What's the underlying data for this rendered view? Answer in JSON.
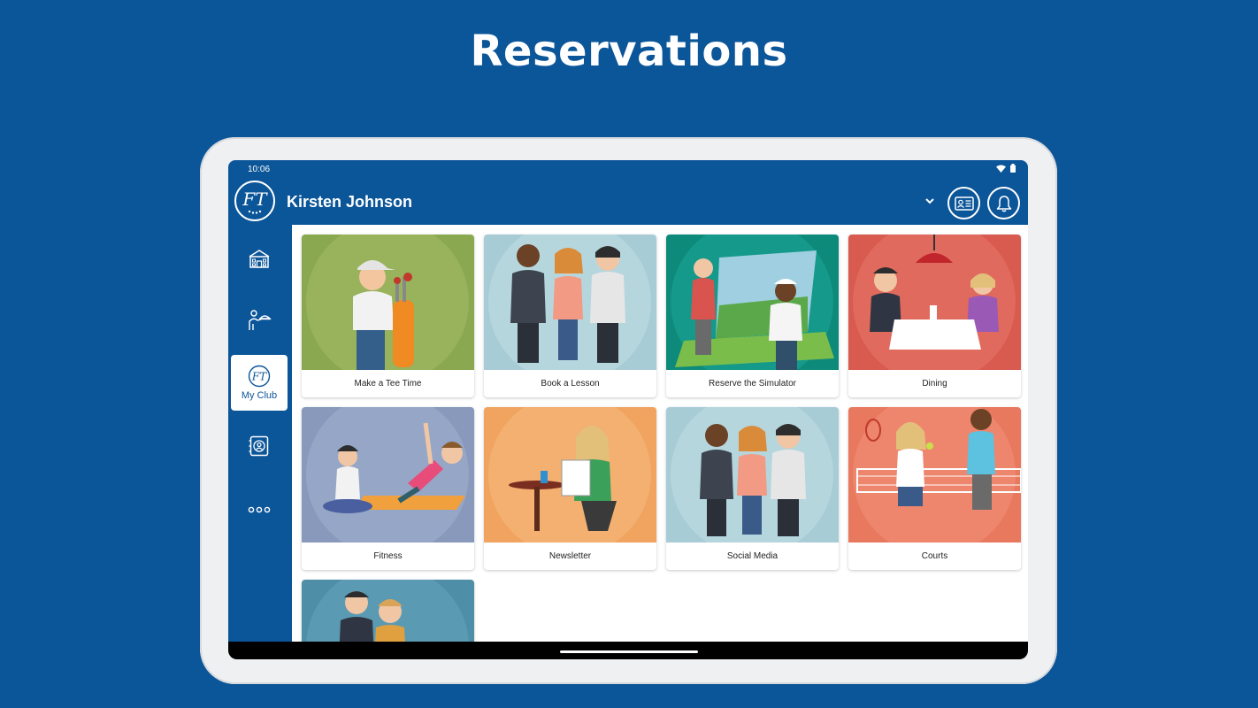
{
  "page": {
    "headline": "Reservations"
  },
  "statusbar": {
    "time": "10:06",
    "wifi_icon": "wifi-icon",
    "battery_icon": "battery-icon"
  },
  "appbar": {
    "logo_text": "FT",
    "user_name": "Kirsten Johnson",
    "dropdown_icon": "chevron-down-icon",
    "card_icon": "member-card-icon",
    "bell_icon": "bell-icon"
  },
  "sidebar": {
    "items": [
      {
        "icon": "clubhouse-icon",
        "label": ""
      },
      {
        "icon": "waiter-icon",
        "label": ""
      },
      {
        "icon": "club-logo-icon",
        "label": "My Club",
        "active": true
      },
      {
        "icon": "member-id-icon",
        "label": ""
      },
      {
        "icon": "more-icon",
        "label": ""
      }
    ]
  },
  "tiles": [
    {
      "label": "Make a Tee Time",
      "bg": "#8aa84f",
      "circle": "#98b35c"
    },
    {
      "label": "Book a Lesson",
      "bg": "#a8ccd6",
      "circle": "#b6d6de"
    },
    {
      "label": "Reserve the Simulator",
      "bg": "#0d8a7a",
      "circle": "#14998a"
    },
    {
      "label": "Dining",
      "bg": "#d95a4e",
      "circle": "#e06a5d"
    },
    {
      "label": "Fitness",
      "bg": "#8899bb",
      "circle": "#95a6c6"
    },
    {
      "label": "Newsletter",
      "bg": "#f0a460",
      "circle": "#f3b071"
    },
    {
      "label": "Social Media",
      "bg": "#a8ccd6",
      "circle": "#b6d6de"
    },
    {
      "label": "Courts",
      "bg": "#e8785e",
      "circle": "#ed866d"
    },
    {
      "label": "",
      "bg": "#4e8ea6",
      "circle": "#5a9ab2"
    }
  ],
  "colors": {
    "brand": "#0b5599",
    "tablet_frame": "#eef0f2"
  }
}
